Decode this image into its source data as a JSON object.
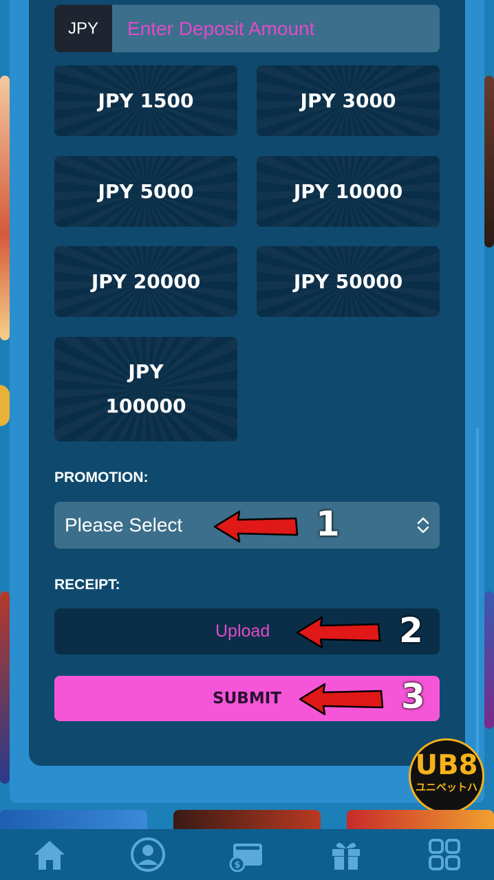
{
  "deposit": {
    "currency": "JPY",
    "amount_placeholder": "Enter Deposit Amount",
    "amount_value": ""
  },
  "presets": [
    {
      "label": "JPY 1500"
    },
    {
      "label": "JPY 3000"
    },
    {
      "label": "JPY 5000"
    },
    {
      "label": "JPY 10000"
    },
    {
      "label": "JPY 20000"
    },
    {
      "label": "JPY 50000"
    },
    {
      "label": "JPY 100000"
    }
  ],
  "promotion": {
    "label": "PROMOTION:",
    "selected": "Please Select"
  },
  "receipt": {
    "label": "RECEIPT:",
    "upload_label": "Upload"
  },
  "submit_label": "SUBMIT",
  "annotations": [
    {
      "number": "1"
    },
    {
      "number": "2"
    },
    {
      "number": "3"
    }
  ],
  "logo": {
    "main": "UB8",
    "sub": "ユニベットハ"
  },
  "colors": {
    "accent": "#f556d8",
    "panel": "#0f4a6e",
    "frame": "#2b8fcf",
    "arrow": "#e01818"
  },
  "nav_icons": [
    "home-icon",
    "profile-icon",
    "wallet-icon",
    "gift-icon",
    "grid-menu-icon"
  ]
}
